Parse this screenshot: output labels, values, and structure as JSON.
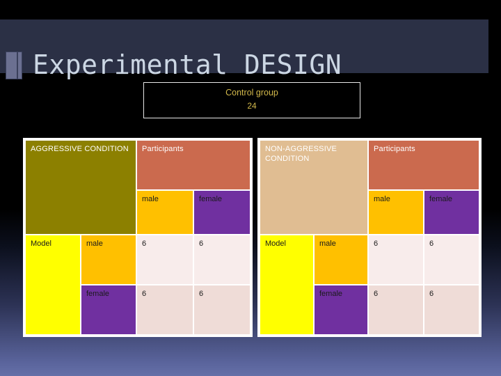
{
  "slide": {
    "title": "Experimental DESIGN",
    "title_icon": "rectangle-bar-icon",
    "background_color": "#000000",
    "title_bar_color": "#2b3045",
    "title_text_color": "#ccd7e4"
  },
  "control_box": {
    "label": "Control group",
    "count": "24",
    "text_color": "#d2b84b",
    "border_color": "#e8e8e8",
    "fill_color": "#000000"
  },
  "palette": {
    "olive": "#8c8000",
    "tan": "#e0bd92",
    "salmon": "#cb6a4e",
    "orange": "#ffc000",
    "purple": "#7030a0",
    "yellow": "#ffff00",
    "data_light": "#f8eceb",
    "data_dark": "#efdcd7"
  },
  "tables": [
    {
      "id": "aggressive",
      "condition_label": "AGGRESSIVE CONDITION",
      "participants_label": "Participants",
      "participant_columns": [
        "male",
        "female"
      ],
      "model_label": "Model",
      "model_rows": [
        "male",
        "female"
      ],
      "values": [
        [
          "6",
          "6"
        ],
        [
          "6",
          "6"
        ]
      ]
    },
    {
      "id": "nonaggressive",
      "condition_label": "NON-AGGRESSIVE CONDITION",
      "participants_label": "Participants",
      "participant_columns": [
        "male",
        "female"
      ],
      "model_label": "Model",
      "model_rows": [
        "male",
        "female"
      ],
      "values": [
        [
          "6",
          "6"
        ],
        [
          "6",
          "6"
        ]
      ]
    }
  ]
}
